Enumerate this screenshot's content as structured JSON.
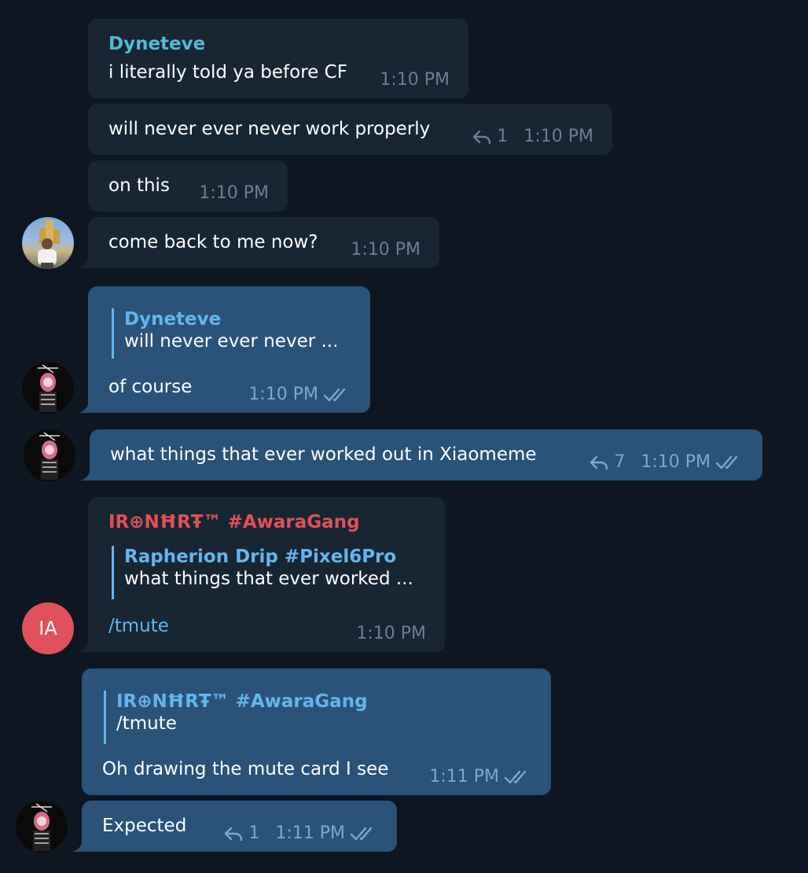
{
  "messages": {
    "m1": {
      "sender": "Dyneteve",
      "text": "i literally told ya before CF",
      "time": "1:10 PM"
    },
    "m2": {
      "text": "will never ever never work properly",
      "replies": "1",
      "time": "1:10 PM"
    },
    "m3": {
      "text": "on this",
      "time": "1:10 PM"
    },
    "m4": {
      "text": "come back to me now?",
      "time": "1:10 PM"
    },
    "m5": {
      "quote_name": "Dyneteve",
      "quote_text": "will never ever never ...",
      "text": "of course",
      "time": "1:10 PM"
    },
    "m6": {
      "text": "what things that ever worked out in Xiaomeme",
      "replies": "7",
      "time": "1:10 PM"
    },
    "m7": {
      "sender": "IR⊕NĦRŦ™ #AwaraGang",
      "quote_name": "Rapherion Drip #Pixel6Pro",
      "quote_text": "what things that ever worked ...",
      "text": "/tmute",
      "time": "1:10 PM"
    },
    "m8": {
      "quote_name": "IR⊕NĦRŦ™ #AwaraGang",
      "quote_text": "/tmute",
      "text": "Oh drawing the mute card I see",
      "time": "1:11 PM"
    },
    "m9": {
      "text": "Expected",
      "replies": "1",
      "time": "1:11 PM"
    }
  },
  "avatars": {
    "ia_initials": "IA"
  },
  "colors": {
    "background": "#0e1621",
    "incoming": "#182533",
    "outgoing": "#2b5278",
    "accent": "#64b5ef",
    "teal": "#52bad5",
    "red": "#e05157"
  },
  "icons": [
    "reply-icon",
    "double-check-icon"
  ]
}
